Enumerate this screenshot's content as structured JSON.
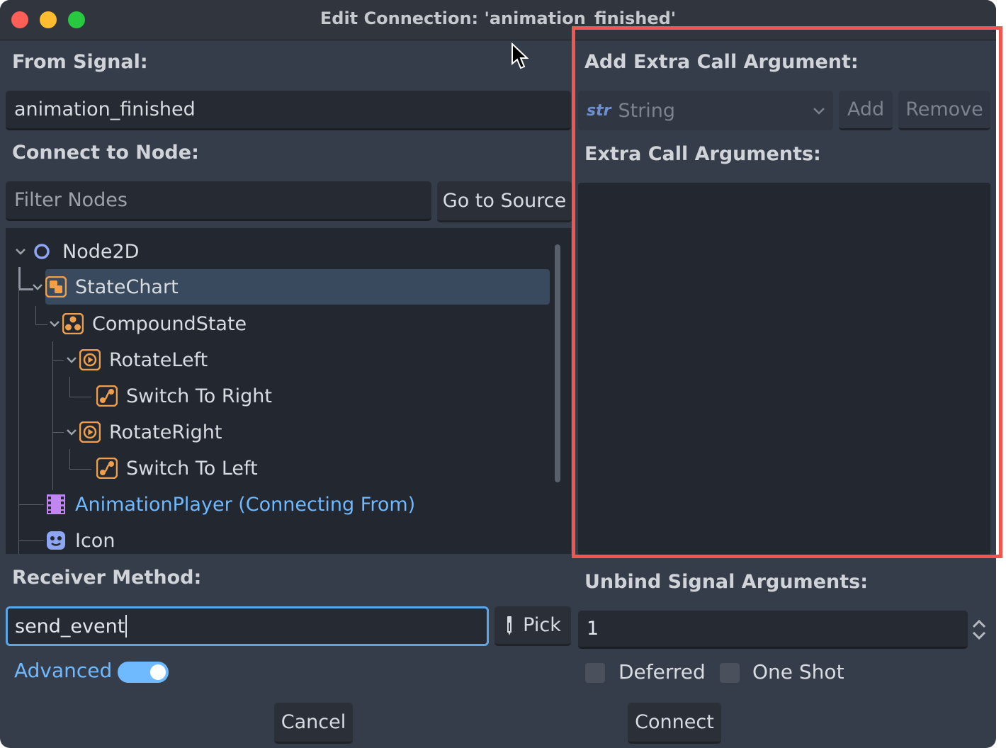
{
  "window": {
    "title": "Edit Connection: 'animation_finished'"
  },
  "from_signal": {
    "label": "From Signal:",
    "value": "animation_finished"
  },
  "connect_to_node": {
    "label": "Connect to Node:",
    "filter_placeholder": "Filter Nodes",
    "go_to_source_label": "Go to Source"
  },
  "tree": {
    "items": [
      {
        "label": "Node2D",
        "icon": "node2d-circle-icon"
      },
      {
        "label": "StateChart",
        "icon": "statechart-icon",
        "selected": true
      },
      {
        "label": "CompoundState",
        "icon": "compound-state-icon"
      },
      {
        "label": "RotateLeft",
        "icon": "atomic-state-icon"
      },
      {
        "label": "Switch To Right",
        "icon": "transition-icon"
      },
      {
        "label": "RotateRight",
        "icon": "atomic-state-icon"
      },
      {
        "label": "Switch To Left",
        "icon": "transition-icon"
      },
      {
        "label": "AnimationPlayer (Connecting From)",
        "icon": "film-strip-icon"
      },
      {
        "label": "Icon",
        "icon": "godot-face-icon"
      }
    ]
  },
  "receiver": {
    "label": "Receiver Method:",
    "value": "send_event",
    "pick_label": "Pick"
  },
  "advanced": {
    "label": "Advanced",
    "enabled": true
  },
  "extra_args": {
    "add_label": "Add Extra Call Argument:",
    "type_value": "String",
    "type_prefix": "str",
    "add_button": "Add",
    "remove_button": "Remove",
    "list_label": "Extra Call Arguments:"
  },
  "unbind": {
    "label": "Unbind Signal Arguments:",
    "value": "1"
  },
  "options": {
    "deferred_label": "Deferred",
    "one_shot_label": "One Shot"
  },
  "footer": {
    "cancel_label": "Cancel",
    "connect_label": "Connect"
  },
  "colors": {
    "accent": "#6eb9ff",
    "highlight_border": "#f2574f",
    "node_orange": "#f0a04b"
  }
}
